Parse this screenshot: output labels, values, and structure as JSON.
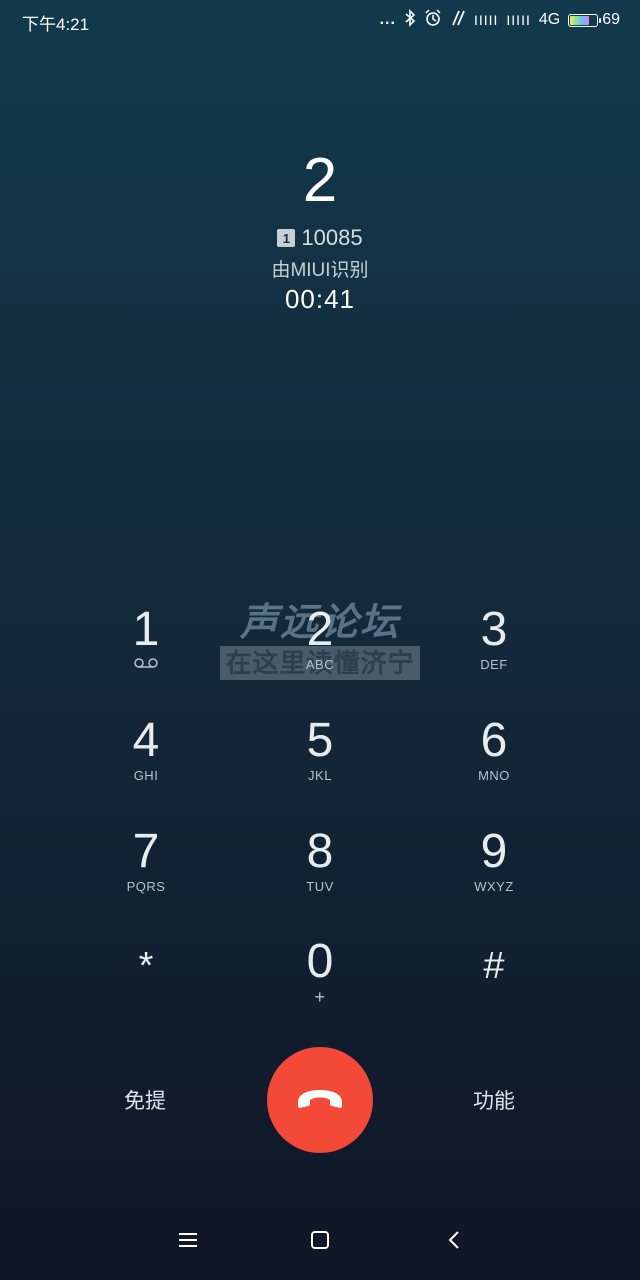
{
  "status_bar": {
    "time": "下午4:21",
    "dots": "...",
    "bluetooth_icon": "bluetooth-icon",
    "alarm_icon": "alarm-icon",
    "signal_1": "IIIII",
    "signal_2": "IIIII",
    "network": "4G",
    "battery_level": "69"
  },
  "call": {
    "caller_name": "2",
    "sim_slot": "1",
    "number": "10085",
    "source": "由MIUI识别",
    "duration": "00:41"
  },
  "watermark": {
    "top": "声远论坛",
    "bottom": "在这里读懂济宁"
  },
  "keypad": [
    {
      "digit": "1",
      "letters": ""
    },
    {
      "digit": "2",
      "letters": "ABC"
    },
    {
      "digit": "3",
      "letters": "DEF"
    },
    {
      "digit": "4",
      "letters": "GHI"
    },
    {
      "digit": "5",
      "letters": "JKL"
    },
    {
      "digit": "6",
      "letters": "MNO"
    },
    {
      "digit": "7",
      "letters": "PQRS"
    },
    {
      "digit": "8",
      "letters": "TUV"
    },
    {
      "digit": "9",
      "letters": "WXYZ"
    },
    {
      "digit": "*",
      "letters": ""
    },
    {
      "digit": "0",
      "letters": "+"
    },
    {
      "digit": "#",
      "letters": ""
    }
  ],
  "controls": {
    "speaker_label": "免提",
    "more_label": "功能",
    "end_call_color": "#f24a37"
  }
}
